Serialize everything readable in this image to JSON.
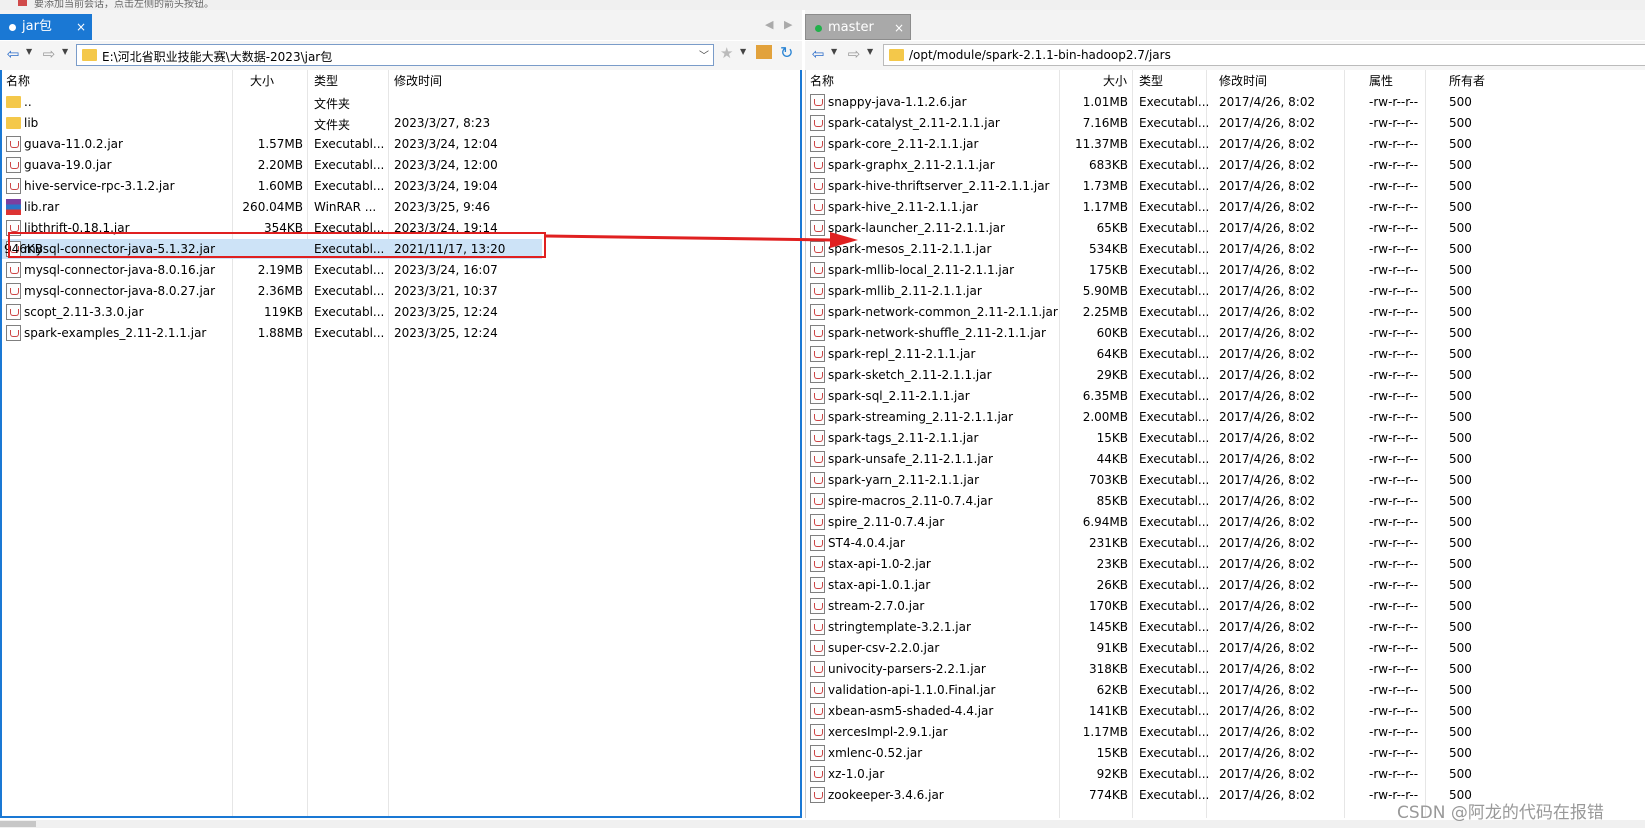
{
  "top_hint": "要添加当前会话，点击左侧的箭头按钮。",
  "left_tab": {
    "label": "jar包",
    "close": "×"
  },
  "right_tab": {
    "label": "master",
    "close": "×"
  },
  "left_path": "E:\\河北省职业技能大赛\\大数据-2023\\jar包",
  "right_path": "/opt/module/spark-2.1.1-bin-hadoop2.7/jars",
  "left_headers": {
    "name": "名称",
    "size": "大小",
    "type": "类型",
    "modified": "修改时间"
  },
  "right_headers": {
    "name": "名称",
    "size": "大小",
    "type": "类型",
    "modified": "修改时间",
    "attr": "属性",
    "owner": "所有者"
  },
  "left_files": [
    {
      "icon": "folder",
      "name": "..",
      "size": "",
      "type": "文件夹",
      "modified": ""
    },
    {
      "icon": "folder",
      "name": "lib",
      "size": "",
      "type": "文件夹",
      "modified": "2023/3/27, 8:23"
    },
    {
      "icon": "jar",
      "name": "guava-11.0.2.jar",
      "size": "1.57MB",
      "type": "Executabl...",
      "modified": "2023/3/24, 12:04"
    },
    {
      "icon": "jar",
      "name": "guava-19.0.jar",
      "size": "2.20MB",
      "type": "Executabl...",
      "modified": "2023/3/24, 12:00"
    },
    {
      "icon": "jar",
      "name": "hive-service-rpc-3.1.2.jar",
      "size": "1.60MB",
      "type": "Executabl...",
      "modified": "2023/3/24, 19:04"
    },
    {
      "icon": "rar",
      "name": "lib.rar",
      "size": "260.04MB",
      "type": "WinRAR ...",
      "modified": "2023/3/25, 9:46"
    },
    {
      "icon": "jar",
      "name": "libthrift-0.18.1.jar",
      "size": "354KB",
      "type": "Executabl...",
      "modified": "2023/3/24, 19:14"
    },
    {
      "icon": "jar",
      "name": "mysql-connector-java-5.1.32.jar",
      "size": "946KB",
      "type": "Executabl...",
      "modified": "2021/11/17, 13:20",
      "selected": true
    },
    {
      "icon": "jar",
      "name": "mysql-connector-java-8.0.16.jar",
      "size": "2.19MB",
      "type": "Executabl...",
      "modified": "2023/3/24, 16:07"
    },
    {
      "icon": "jar",
      "name": "mysql-connector-java-8.0.27.jar",
      "size": "2.36MB",
      "type": "Executabl...",
      "modified": "2023/3/21, 10:37"
    },
    {
      "icon": "jar",
      "name": "scopt_2.11-3.3.0.jar",
      "size": "119KB",
      "type": "Executabl...",
      "modified": "2023/3/25, 12:24"
    },
    {
      "icon": "jar",
      "name": "spark-examples_2.11-2.1.1.jar",
      "size": "1.88MB",
      "type": "Executabl...",
      "modified": "2023/3/25, 12:24"
    }
  ],
  "right_files": [
    {
      "name": "snappy-java-1.1.2.6.jar",
      "size": "1.01MB"
    },
    {
      "name": "spark-catalyst_2.11-2.1.1.jar",
      "size": "7.16MB"
    },
    {
      "name": "spark-core_2.11-2.1.1.jar",
      "size": "11.37MB"
    },
    {
      "name": "spark-graphx_2.11-2.1.1.jar",
      "size": "683KB"
    },
    {
      "name": "spark-hive-thriftserver_2.11-2.1.1.jar",
      "size": "1.73MB"
    },
    {
      "name": "spark-hive_2.11-2.1.1.jar",
      "size": "1.17MB"
    },
    {
      "name": "spark-launcher_2.11-2.1.1.jar",
      "size": "65KB"
    },
    {
      "name": "spark-mesos_2.11-2.1.1.jar",
      "size": "534KB"
    },
    {
      "name": "spark-mllib-local_2.11-2.1.1.jar",
      "size": "175KB"
    },
    {
      "name": "spark-mllib_2.11-2.1.1.jar",
      "size": "5.90MB"
    },
    {
      "name": "spark-network-common_2.11-2.1.1.jar",
      "size": "2.25MB"
    },
    {
      "name": "spark-network-shuffle_2.11-2.1.1.jar",
      "size": "60KB"
    },
    {
      "name": "spark-repl_2.11-2.1.1.jar",
      "size": "64KB"
    },
    {
      "name": "spark-sketch_2.11-2.1.1.jar",
      "size": "29KB"
    },
    {
      "name": "spark-sql_2.11-2.1.1.jar",
      "size": "6.35MB"
    },
    {
      "name": "spark-streaming_2.11-2.1.1.jar",
      "size": "2.00MB"
    },
    {
      "name": "spark-tags_2.11-2.1.1.jar",
      "size": "15KB"
    },
    {
      "name": "spark-unsafe_2.11-2.1.1.jar",
      "size": "44KB"
    },
    {
      "name": "spark-yarn_2.11-2.1.1.jar",
      "size": "703KB"
    },
    {
      "name": "spire-macros_2.11-0.7.4.jar",
      "size": "85KB"
    },
    {
      "name": "spire_2.11-0.7.4.jar",
      "size": "6.94MB"
    },
    {
      "name": "ST4-4.0.4.jar",
      "size": "231KB"
    },
    {
      "name": "stax-api-1.0-2.jar",
      "size": "23KB"
    },
    {
      "name": "stax-api-1.0.1.jar",
      "size": "26KB"
    },
    {
      "name": "stream-2.7.0.jar",
      "size": "170KB"
    },
    {
      "name": "stringtemplate-3.2.1.jar",
      "size": "145KB"
    },
    {
      "name": "super-csv-2.2.0.jar",
      "size": "91KB"
    },
    {
      "name": "univocity-parsers-2.2.1.jar",
      "size": "318KB"
    },
    {
      "name": "validation-api-1.1.0.Final.jar",
      "size": "62KB"
    },
    {
      "name": "xbean-asm5-shaded-4.4.jar",
      "size": "141KB"
    },
    {
      "name": "xercesImpl-2.9.1.jar",
      "size": "1.17MB"
    },
    {
      "name": "xmlenc-0.52.jar",
      "size": "15KB"
    },
    {
      "name": "xz-1.0.jar",
      "size": "92KB"
    },
    {
      "name": "zookeeper-3.4.6.jar",
      "size": "774KB"
    }
  ],
  "right_common": {
    "type": "Executabl...",
    "modified": "2017/4/26, 8:02",
    "attr": "-rw-r--r--",
    "owner": "500"
  },
  "watermark": "CSDN @阿龙的代码在报错",
  "colors": {
    "accent": "#1a78d4",
    "selection": "#cde3f7",
    "annotation": "#e02020"
  }
}
